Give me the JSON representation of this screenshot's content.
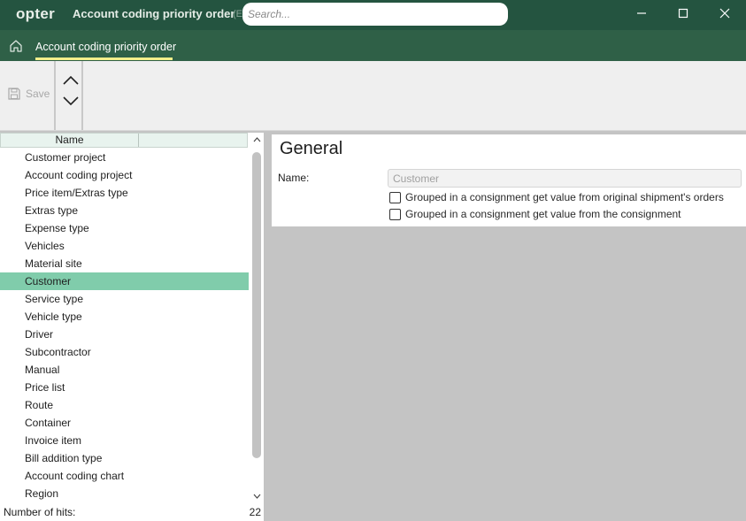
{
  "app": {
    "logo": "opter",
    "window_title": "Account coding priority order",
    "window_title_extra": "(E",
    "search_placeholder": "Search..."
  },
  "tabs": {
    "active_label": "Account coding priority order"
  },
  "toolbar": {
    "save_label": "Save"
  },
  "list": {
    "column_header": "Name",
    "items": [
      "Customer project",
      "Account coding project",
      "Price item/Extras type",
      "Extras type",
      "Expense type",
      "Vehicles",
      "Material site",
      "Customer",
      "Service type",
      "Vehicle type",
      "Driver",
      "Subcontractor",
      "Manual",
      "Price list",
      "Route",
      "Container",
      "Invoice item",
      "Bill addition type",
      "Account coding chart",
      "Region"
    ],
    "selected_index": 7,
    "hits_label": "Number of hits:",
    "hits_value": "22"
  },
  "detail": {
    "title": "General",
    "name_label": "Name:",
    "name_value": "Customer",
    "checkbox_1": "Grouped in a consignment get value from original shipment's orders",
    "checkbox_2": "Grouped in a consignment get value from the consignment"
  },
  "colors": {
    "titlebar": "#245440",
    "tabbar": "#2f6047",
    "tab_underline": "#f2ee8a",
    "selection": "#80ccab"
  }
}
